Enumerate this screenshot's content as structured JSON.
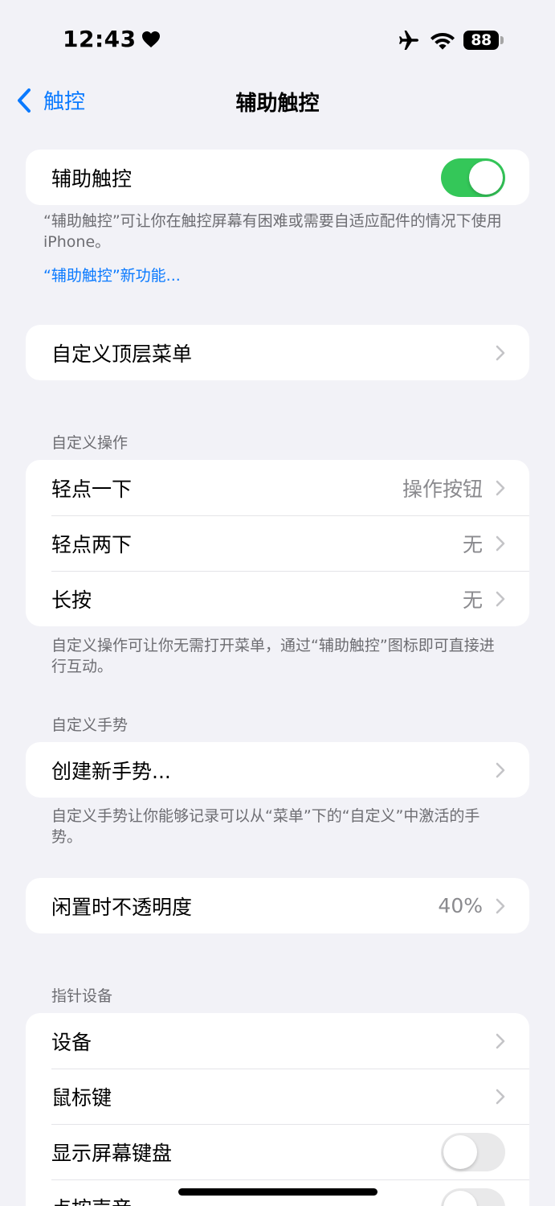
{
  "status_bar": {
    "time": "12:43",
    "battery": "88"
  },
  "nav": {
    "back_label": "触控",
    "title": "辅助触控"
  },
  "assistive_touch": {
    "label": "辅助触控",
    "enabled": true,
    "footnote": "“辅助触控”可让你在触控屏幕有困难或需要自适应配件的情况下使用 iPhone。",
    "link": "“辅助触控”新功能..."
  },
  "top_menu": {
    "label": "自定义顶层菜单"
  },
  "custom_actions": {
    "header": "自定义操作",
    "rows": [
      {
        "label": "轻点一下",
        "value": "操作按钮"
      },
      {
        "label": "轻点两下",
        "value": "无"
      },
      {
        "label": "长按",
        "value": "无"
      }
    ],
    "footnote": "自定义操作可让你无需打开菜单，通过“辅助触控”图标即可直接进行互动。"
  },
  "custom_gestures": {
    "header": "自定义手势",
    "create_label": "创建新手势...",
    "footnote": "自定义手势让你能够记录可以从“菜单”下的“自定义”中激活的手势。"
  },
  "idle_opacity": {
    "label": "闲置时不透明度",
    "value": "40%"
  },
  "pointer_devices": {
    "header": "指针设备",
    "devices_label": "设备",
    "mouse_keys_label": "鼠标键",
    "onscreen_keyboard_label": "显示屏幕键盘",
    "onscreen_keyboard_enabled": false,
    "click_sound_label": "点按声音",
    "click_sound_enabled": false
  },
  "colors": {
    "accent": "#0a7aff",
    "toggle_on": "#34c759",
    "toggle_off": "#e9e9ea",
    "background": "#f2f2f7"
  }
}
